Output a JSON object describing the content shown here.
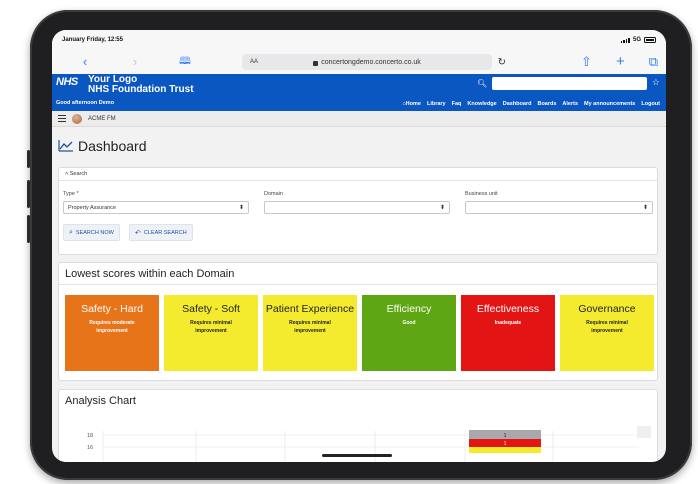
{
  "status_bar": {
    "time": "January Friday, 12:55",
    "network": "5G"
  },
  "browser": {
    "aa": "AA",
    "url": "concertongdemo.concerto.co.uk",
    "icons": [
      "back-icon",
      "forward-icon",
      "book-icon",
      "reload-icon",
      "share-icon",
      "new-tab-icon",
      "tabs-icon"
    ]
  },
  "header": {
    "logo": "NHS",
    "org_line1": "Your Logo",
    "org_line2": "NHS Foundation Trust",
    "greeting": "Good afternoon Demo",
    "nav": [
      "Home",
      "Library",
      "Faq",
      "Knowledge",
      "Dashboard",
      "Boards",
      "Alerts",
      "My announcements",
      "Logout"
    ]
  },
  "appbar": {
    "user": "ACME FM"
  },
  "page": {
    "title": "Dashboard"
  },
  "search": {
    "toggle_label": "Search",
    "type_label": "Type",
    "type_required_mark": "*",
    "type_value": "Property Assurance",
    "domain_label": "Domain",
    "domain_value": "",
    "business_unit_label": "Business unit",
    "business_unit_value": "",
    "search_now": "SEARCH NOW",
    "clear_search": "CLEAR SEARCH"
  },
  "scores": {
    "title": "Lowest scores within each Domain",
    "tiles": [
      {
        "name": "Safety - Hard",
        "status": "Requires moderate improvement",
        "color": "#e8741a"
      },
      {
        "name": "Safety - Soft",
        "status": "Requires minimal improvement",
        "color": "#f4ea2e"
      },
      {
        "name": "Patient Experience",
        "status": "Requires minimal improvement",
        "color": "#f4ea2e"
      },
      {
        "name": "Efficiency",
        "status": "Good",
        "color": "#5fa614"
      },
      {
        "name": "Effectiveness",
        "status": "Inadequate",
        "color": "#e31414"
      },
      {
        "name": "Governance",
        "status": "Requires minimal improvement",
        "color": "#f4ea2e"
      }
    ]
  },
  "analysis": {
    "title": "Analysis Chart",
    "y_ticks": [
      "18",
      "16"
    ],
    "bar_labels": [
      "1",
      "1"
    ]
  }
}
